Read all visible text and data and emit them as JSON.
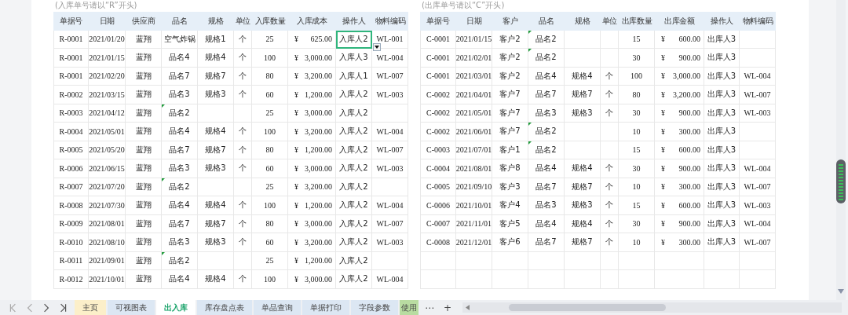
{
  "inbound": {
    "note": "(入库单号请以“R”开头)",
    "columns": [
      "单据号",
      "日期",
      "供应商",
      "品名",
      "规格",
      "单位",
      "入库数量",
      "入库成本",
      "操作人",
      "物料编码"
    ],
    "rows": [
      {
        "cells": [
          "R-0001",
          "2021/01/20",
          "蓝翔",
          "空气炸锅",
          "规格1",
          "个",
          "25",
          "625.00",
          "入库人2",
          "WL-001"
        ],
        "currency": "¥",
        "flag": false,
        "selected": true
      },
      {
        "cells": [
          "R-0001",
          "2021/01/15",
          "蓝翔",
          "品名4",
          "规格4",
          "个",
          "100",
          "3,000.00",
          "入库人3",
          "WL-004"
        ],
        "currency": "¥",
        "flag": false,
        "selected": false
      },
      {
        "cells": [
          "R-0001",
          "2021/02/20",
          "蓝翔",
          "品名7",
          "规格7",
          "个",
          "80",
          "3,200.00",
          "入库人1",
          "WL-007"
        ],
        "currency": "¥",
        "flag": false,
        "selected": false
      },
      {
        "cells": [
          "R-0002",
          "2021/03/15",
          "蓝翔",
          "品名3",
          "规格3",
          "个",
          "60",
          "1,200.00",
          "入库人2",
          "WL-003"
        ],
        "currency": "¥",
        "flag": false,
        "selected": false
      },
      {
        "cells": [
          "R-0003",
          "2021/04/12",
          "蓝翔",
          "品名2",
          null,
          null,
          "25",
          "3,000.00",
          "入库人2",
          null
        ],
        "currency": "¥",
        "flag": true,
        "selected": false
      },
      {
        "cells": [
          "R-0004",
          "2021/05/01",
          "蓝翔",
          "品名4",
          "规格4",
          "个",
          "100",
          "3,200.00",
          "入库人2",
          "WL-004"
        ],
        "currency": "¥",
        "flag": false,
        "selected": false
      },
      {
        "cells": [
          "R-0005",
          "2021/05/20",
          "蓝翔",
          "品名7",
          "规格7",
          "个",
          "80",
          "1,200.00",
          "入库人2",
          "WL-007"
        ],
        "currency": "¥",
        "flag": false,
        "selected": false
      },
      {
        "cells": [
          "R-0006",
          "2021/06/15",
          "蓝翔",
          "品名3",
          "规格3",
          "个",
          "60",
          "3,000.00",
          "入库人2",
          "WL-003"
        ],
        "currency": "¥",
        "flag": false,
        "selected": false
      },
      {
        "cells": [
          "R-0007",
          "2021/07/20",
          "蓝翔",
          "品名2",
          null,
          null,
          "25",
          "3,200.00",
          "入库人2",
          null
        ],
        "currency": "¥",
        "flag": true,
        "selected": false
      },
      {
        "cells": [
          "R-0008",
          "2021/07/30",
          "蓝翔",
          "品名4",
          "规格4",
          "个",
          "100",
          "1,200.00",
          "入库人2",
          "WL-004"
        ],
        "currency": "¥",
        "flag": false,
        "selected": false
      },
      {
        "cells": [
          "R-0009",
          "2021/08/01",
          "蓝翔",
          "品名7",
          "规格7",
          "个",
          "80",
          "3,000.00",
          "入库人2",
          "WL-007"
        ],
        "currency": "¥",
        "flag": false,
        "selected": false
      },
      {
        "cells": [
          "R-0010",
          "2021/08/10",
          "蓝翔",
          "品名3",
          "规格3",
          "个",
          "60",
          "3,200.00",
          "入库人2",
          "WL-003"
        ],
        "currency": "¥",
        "flag": false,
        "selected": false
      },
      {
        "cells": [
          "R-0011",
          "2021/09/01",
          "蓝翔",
          "品名2",
          null,
          null,
          "25",
          "1,200.00",
          "入库人2",
          null
        ],
        "currency": "¥",
        "flag": true,
        "selected": false
      },
      {
        "cells": [
          "R-0012",
          "2021/10/01",
          "蓝翔",
          "品名4",
          "规格4",
          "个",
          "100",
          "3,000.00",
          "入库人2",
          "WL-004"
        ],
        "currency": "¥",
        "flag": false,
        "selected": false
      }
    ]
  },
  "outbound": {
    "note": "(出库单号请以“C”开头)",
    "columns": [
      "单据号",
      "日期",
      "客户",
      "品名",
      "规格",
      "单位",
      "出库数量",
      "出库金额",
      "操作人",
      "物料编码"
    ],
    "rows": [
      {
        "cells": [
          "C-0001",
          "2021/01/15",
          "客户2",
          "品名2",
          null,
          null,
          "15",
          "600.00",
          "出库人3",
          null
        ],
        "currency": "¥",
        "flag": true,
        "selected": false
      },
      {
        "cells": [
          "C-0001",
          "2021/02/01",
          "客户2",
          "品名2",
          null,
          null,
          "30",
          "900.00",
          "出库人3",
          null
        ],
        "currency": "¥",
        "flag": true,
        "selected": false
      },
      {
        "cells": [
          "C-0001",
          "2021/03/01",
          "客户2",
          "品名4",
          "规格4",
          "个",
          "100",
          "3,000.00",
          "出库人3",
          "WL-004"
        ],
        "currency": "¥",
        "flag": false,
        "selected": false
      },
      {
        "cells": [
          "C-0002",
          "2021/04/01",
          "客户7",
          "品名7",
          "规格7",
          "个",
          "80",
          "3,200.00",
          "出库人3",
          "WL-007"
        ],
        "currency": "¥",
        "flag": false,
        "selected": false
      },
      {
        "cells": [
          "C-0002",
          "2021/05/01",
          "客户7",
          "品名3",
          "规格3",
          "个",
          "30",
          "900.00",
          "出库人3",
          "WL-003"
        ],
        "currency": "¥",
        "flag": false,
        "selected": false
      },
      {
        "cells": [
          "C-0002",
          "2021/06/01",
          "客户7",
          "品名2",
          null,
          null,
          "10",
          "300.00",
          "出库人3",
          null
        ],
        "currency": "¥",
        "flag": true,
        "selected": false
      },
      {
        "cells": [
          "C-0003",
          "2021/07/01",
          "客户1",
          "品名2",
          null,
          null,
          "15",
          "600.00",
          "出库人3",
          null
        ],
        "currency": "¥",
        "flag": true,
        "selected": false
      },
      {
        "cells": [
          "C-0004",
          "2021/08/01",
          "客户8",
          "品名4",
          "规格4",
          "个",
          "30",
          "900.00",
          "出库人3",
          "WL-004"
        ],
        "currency": "¥",
        "flag": false,
        "selected": false
      },
      {
        "cells": [
          "C-0005",
          "2021/09/10",
          "客户3",
          "品名7",
          "规格7",
          "个",
          "10",
          "300.00",
          "出库人3",
          "WL-007"
        ],
        "currency": "¥",
        "flag": false,
        "selected": false
      },
      {
        "cells": [
          "C-0006",
          "2021/10/01",
          "客户4",
          "品名3",
          "规格3",
          "个",
          "15",
          "600.00",
          "出库人3",
          "WL-003"
        ],
        "currency": "¥",
        "flag": false,
        "selected": false
      },
      {
        "cells": [
          "C-0007",
          "2021/11/01",
          "客户5",
          "品名4",
          "规格4",
          "个",
          "30",
          "900.00",
          "出库人3",
          "WL-004"
        ],
        "currency": "¥",
        "flag": false,
        "selected": false
      },
      {
        "cells": [
          "C-0008",
          "2021/12/01",
          "客户6",
          "品名7",
          "规格7",
          "个",
          "10",
          "300.00",
          "出库人3",
          "WL-007"
        ],
        "currency": "¥",
        "flag": false,
        "selected": false
      }
    ]
  },
  "sheet_tabs": [
    {
      "label": "主页",
      "selected": false,
      "color": "#fcefc9"
    },
    {
      "label": "可视图表",
      "selected": false,
      "color": "#dce7f3"
    },
    {
      "label": "出入库",
      "selected": true,
      "color": "#ffffff"
    },
    {
      "label": "库存盘点表",
      "selected": false,
      "color": "#dce7f3"
    },
    {
      "label": "单品查询",
      "selected": false,
      "color": "#dce7f3"
    },
    {
      "label": "单据打印",
      "selected": false,
      "color": "#dce7f3"
    },
    {
      "label": "字段参数",
      "selected": false,
      "color": "#dce7f3"
    },
    {
      "label": "使用",
      "selected": false,
      "color": "#b9dca1"
    }
  ],
  "more_tabs": "⋯",
  "add_tab": "+"
}
